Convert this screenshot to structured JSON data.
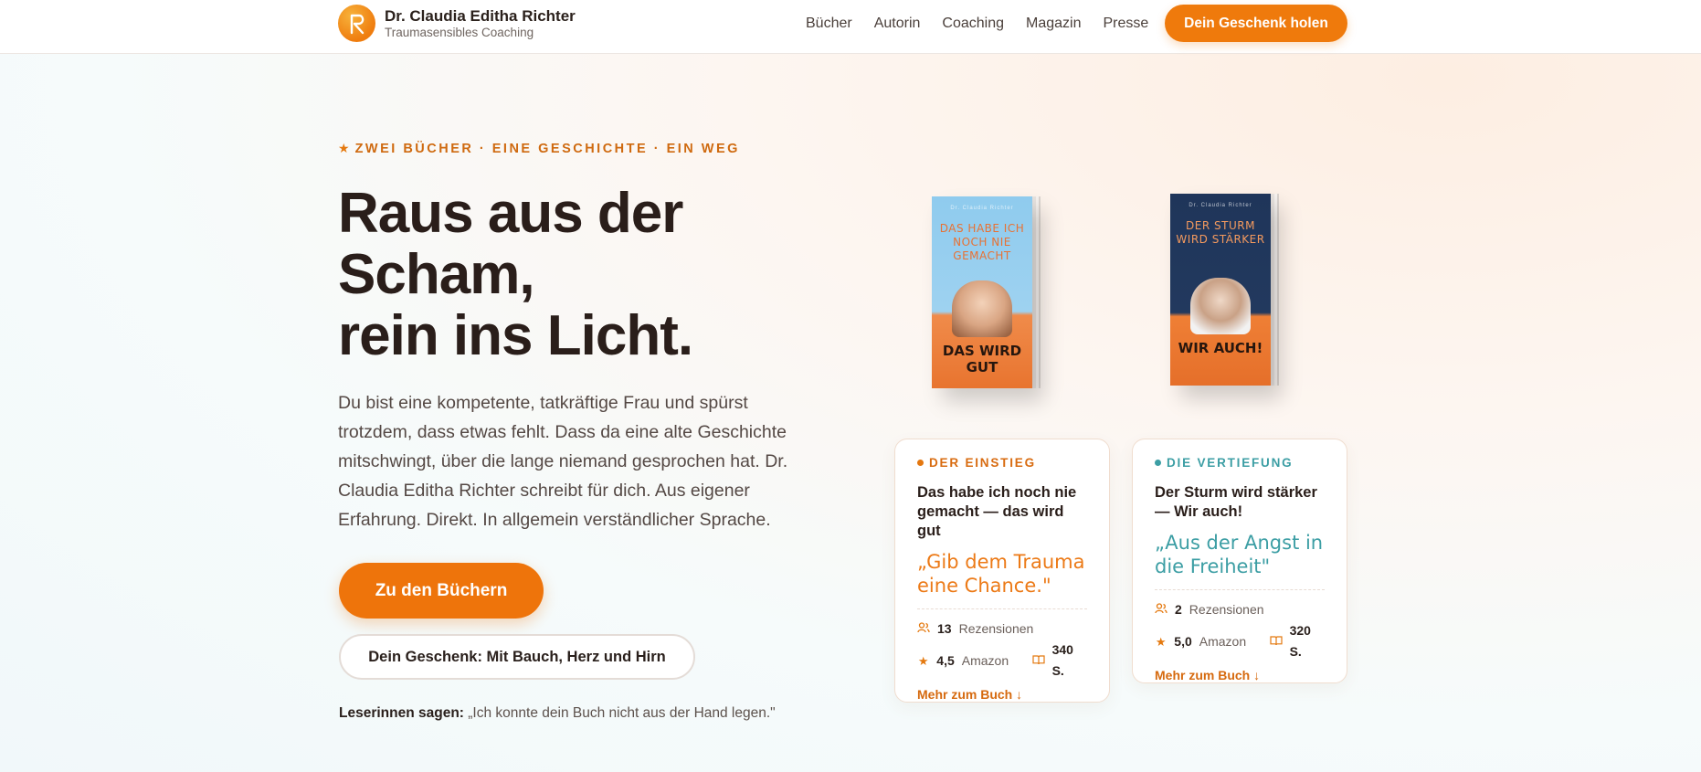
{
  "brand": {
    "name": "Dr. Claudia Editha Richter",
    "subtitle": "Traumasensibles Coaching"
  },
  "nav": {
    "items": [
      "Bücher",
      "Autorin",
      "Coaching",
      "Magazin",
      "Presse"
    ],
    "cta": "Dein Geschenk holen"
  },
  "hero": {
    "eyebrow": "ZWEI BÜCHER · EINE GESCHICHTE · EIN WEG",
    "headline_line1": "Raus aus der",
    "headline_line2": "Scham,",
    "headline_line3": "rein ins Licht.",
    "lead": "Du bist eine kompetente, tatkräftige Frau und spürst trotzdem, dass etwas fehlt. Dass da eine alte Geschichte mitschwingt, über die lange niemand gesprochen hat. Dr. Claudia Editha Richter schreibt für dich. Aus eigener Erfahrung. Direkt. In allgemein verständlicher Sprache.",
    "primary_button": "Zu den Büchern",
    "secondary_button": "Dein Geschenk: Mit Bauch, Herz und Hirn",
    "testimonial_label": "Leserinnen sagen:",
    "testimonial_text": " „Ich konnte dein Buch nicht aus der Hand legen.\""
  },
  "books": [
    {
      "cover_author": "Dr. Claudia Richter",
      "cover_title": "DAS HABE ICH NOCH NIE GEMACHT",
      "cover_subtitle": "DAS WIRD GUT",
      "tag": "DER EINSTIEG",
      "title": "Das habe ich noch nie gemacht — das wird gut",
      "quote": "„Gib dem Trauma eine Chance.\"",
      "reviews_count": "13",
      "reviews_label": "Rezensionen",
      "rating": "4,5",
      "rating_source": "Amazon",
      "pages": "340 S.",
      "more": "Mehr zum Buch ↓"
    },
    {
      "cover_author": "Dr. Claudia Richter",
      "cover_title": "DER STURM WIRD STÄRKER",
      "cover_subtitle": "WIR AUCH!",
      "tag": "DIE VERTIEFUNG",
      "title": "Der Sturm wird stärker — Wir auch!",
      "quote": "„Aus der Angst in die Freiheit\"",
      "reviews_count": "2",
      "reviews_label": "Rezensionen",
      "rating": "5,0",
      "rating_source": "Amazon",
      "pages": "320 S.",
      "more": "Mehr zum Buch ↓"
    }
  ],
  "colors": {
    "accent": "#ee740b",
    "teal": "#3c9ea4",
    "text": "#2a1e1a"
  },
  "icons": [
    "logo-r-icon",
    "star-icon",
    "people-icon",
    "book-icon"
  ]
}
